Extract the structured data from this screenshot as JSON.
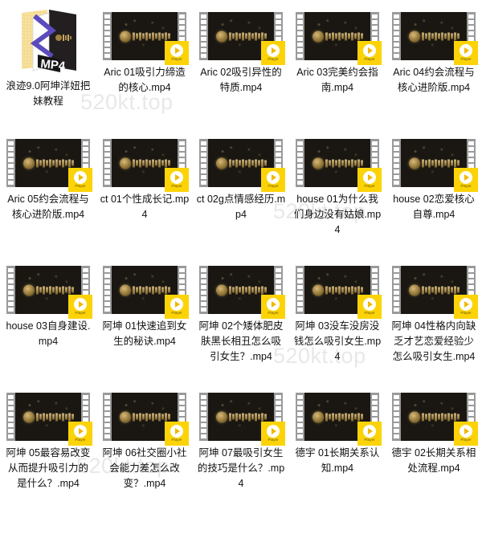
{
  "window": {
    "background_color": "#ffffff",
    "watermark_text": "520kt.top",
    "watermark_color": "#e8e8e8"
  },
  "colors": {
    "badge_yellow": "#fcd307",
    "film_dark": "#1a1712",
    "film_sprocket_gray": "#9a9a9a",
    "folder_yellow": "#f5dc93",
    "folder_dark": "#231f20",
    "caption_text": "#111111"
  },
  "badge": {
    "label": "Player",
    "icon": "play-circle-icon"
  },
  "items": [
    {
      "type": "folder",
      "icon": "mp4-folder-icon",
      "label": "浪迹9.0阿坤洋妞把妹教程"
    },
    {
      "type": "video",
      "icon": "film-strip-thumbnail",
      "label": "Aric 01吸引力缔造的核心.mp4"
    },
    {
      "type": "video",
      "icon": "film-strip-thumbnail",
      "label": "Aric 02吸引异性的特质.mp4"
    },
    {
      "type": "video",
      "icon": "film-strip-thumbnail",
      "label": "Aric 03完美约会指南.mp4"
    },
    {
      "type": "video",
      "icon": "film-strip-thumbnail",
      "label": "Aric 04约会流程与核心进阶版.mp4"
    },
    {
      "type": "video",
      "icon": "film-strip-thumbnail",
      "label": "Aric 05约会流程与核心进阶版.mp4"
    },
    {
      "type": "video",
      "icon": "film-strip-thumbnail",
      "label": "ct 01个性成长记.mp4"
    },
    {
      "type": "video",
      "icon": "film-strip-thumbnail",
      "label": "ct 02g点情感经历.mp4"
    },
    {
      "type": "video",
      "icon": "film-strip-thumbnail",
      "label": "house 01为什么我们身边没有姑娘.mp4"
    },
    {
      "type": "video",
      "icon": "film-strip-thumbnail",
      "label": "house 02恋爱核心 自尊.mp4"
    },
    {
      "type": "video",
      "icon": "film-strip-thumbnail",
      "label": "house 03自身建设.mp4"
    },
    {
      "type": "video",
      "icon": "film-strip-thumbnail",
      "label": "阿坤 01快速追到女生的秘诀.mp4"
    },
    {
      "type": "video",
      "icon": "film-strip-thumbnail",
      "label": "阿坤 02个矮体肥皮肤黑长相丑怎么吸引女生？.mp4"
    },
    {
      "type": "video",
      "icon": "film-strip-thumbnail",
      "label": "阿坤 03没车没房没钱怎么吸引女生.mp4"
    },
    {
      "type": "video",
      "icon": "film-strip-thumbnail",
      "label": "阿坤 04性格内向缺乏才艺恋爱经验少怎么吸引女生.mp4"
    },
    {
      "type": "video",
      "icon": "film-strip-thumbnail",
      "label": "阿坤 05最容易改变从而提升吸引力的是什么？.mp4"
    },
    {
      "type": "video",
      "icon": "film-strip-thumbnail",
      "label": "阿坤 06社交圈小社会能力差怎么改变？.mp4"
    },
    {
      "type": "video",
      "icon": "film-strip-thumbnail",
      "label": "阿坤 07最吸引女生的技巧是什么？.mp4"
    },
    {
      "type": "video",
      "icon": "film-strip-thumbnail",
      "label": "德宇 01长期关系认知.mp4"
    },
    {
      "type": "video",
      "icon": "film-strip-thumbnail",
      "label": "德宇 02长期关系相处流程.mp4"
    }
  ]
}
